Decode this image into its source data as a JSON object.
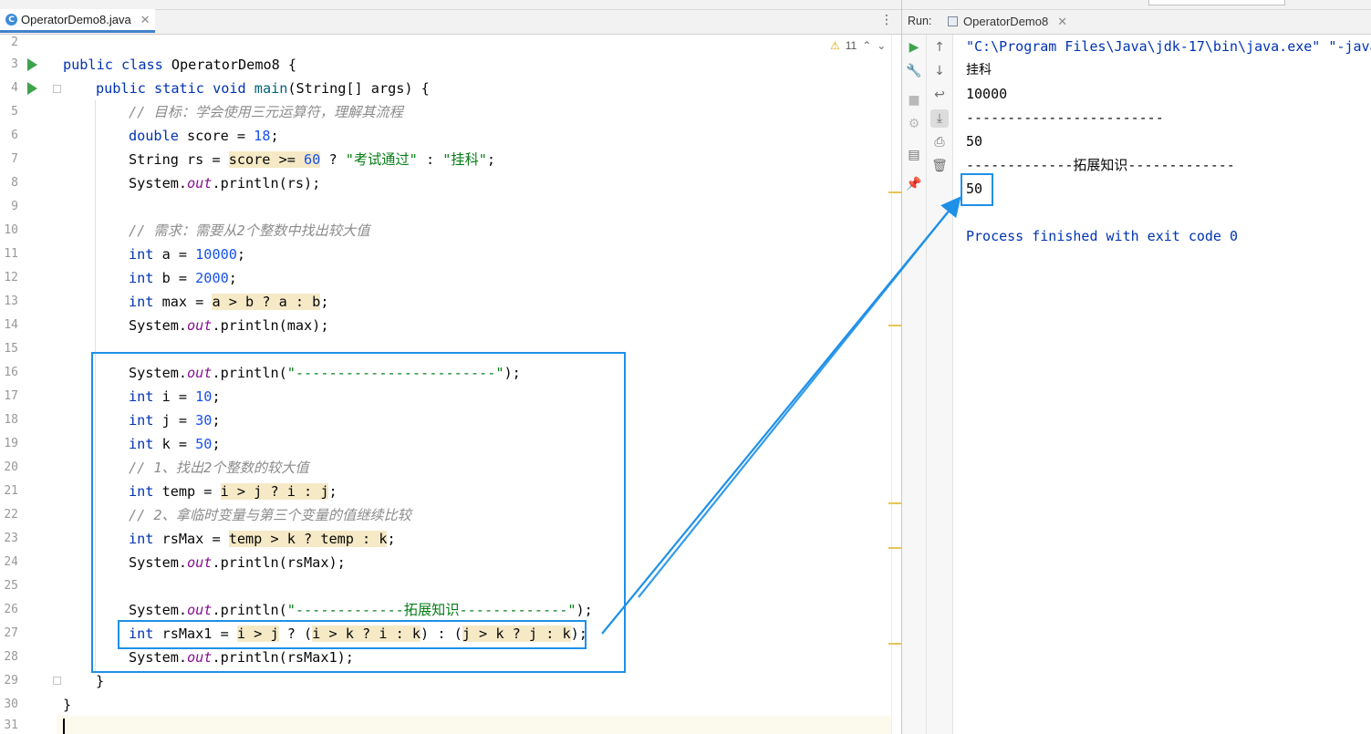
{
  "editor": {
    "tab_label": "OperatorDemo8.java",
    "tab_close": "✕",
    "menu_glyph": "⋮",
    "inspection_count": "11",
    "inspection_up": "⌃",
    "inspection_down": "⌄",
    "line_numbers": [
      "2",
      "3",
      "4",
      "5",
      "6",
      "7",
      "8",
      "9",
      "10",
      "11",
      "12",
      "13",
      "14",
      "15",
      "16",
      "17",
      "18",
      "19",
      "20",
      "21",
      "22",
      "23",
      "24",
      "25",
      "26",
      "27",
      "28",
      "29",
      "30",
      "31"
    ],
    "code": {
      "l3": {
        "kw1": "public",
        "kw2": "class",
        "rest": " OperatorDemo8 {"
      },
      "l4": {
        "kw1": "public",
        "kw2": "static",
        "kw3": "void",
        "name": "main",
        "rest": "(String[] args) {"
      },
      "l5": {
        "comment": "// 目标：学会使用三元运算符，理解其流程"
      },
      "l6": {
        "kw": "double",
        "a": " score = ",
        "n": "18",
        "b": ";"
      },
      "l7": {
        "a": "String rs = ",
        "h1": "score >= ",
        "n": "60",
        "b": " ? ",
        "s1": "\"考试通过\"",
        "c": " : ",
        "s2": "\"挂科\"",
        "d": ";"
      },
      "l8": {
        "a": "System.",
        "f": "out",
        "b": ".println(rs);"
      },
      "l10": {
        "comment": "// 需求：需要从2个整数中找出较大值"
      },
      "l11": {
        "kw": "int",
        "a": " a = ",
        "n": "10000",
        "b": ";"
      },
      "l12": {
        "kw": "int",
        "a": " b = ",
        "n": "2000",
        "b": ";"
      },
      "l13": {
        "kw": "int",
        "a": " max = ",
        "h": "a > b ? a : b",
        "b": ";"
      },
      "l14": {
        "a": "System.",
        "f": "out",
        "b": ".println(max);"
      },
      "l16": {
        "a": "System.",
        "f": "out",
        "b": ".println(",
        "s": "\"------------------------\"",
        "c": ");"
      },
      "l17": {
        "kw": "int",
        "a": " i = ",
        "n": "10",
        "b": ";"
      },
      "l18": {
        "kw": "int",
        "a": " j = ",
        "n": "30",
        "b": ";"
      },
      "l19": {
        "kw": "int",
        "a": " k = ",
        "n": "50",
        "b": ";"
      },
      "l20": {
        "comment": "// 1、找出2个整数的较大值"
      },
      "l21": {
        "kw": "int",
        "a": " temp = ",
        "h": "i > j ? i : j",
        "b": ";"
      },
      "l22": {
        "comment": "// 2、拿临时变量与第三个变量的值继续比较"
      },
      "l23": {
        "kw": "int",
        "a": " rsMax = ",
        "h": "temp > k ? temp : k",
        "b": ";"
      },
      "l24": {
        "a": "System.",
        "f": "out",
        "b": ".println(rsMax);"
      },
      "l26": {
        "a": "System.",
        "f": "out",
        "b": ".println(",
        "s": "\"-------------拓展知识-------------\"",
        "c": ");"
      },
      "l27": {
        "kw": "int",
        "a": " rsMax1 = ",
        "h1": "i > j",
        "b": " ? (",
        "h2": "i > k ? i : k",
        "c": ") : (",
        "h3": "j > k ? j : k",
        "d": ");"
      },
      "l28": {
        "a": "System.",
        "f": "out",
        "b": ".println(rsMax1);"
      },
      "l29": {
        "rest": "}"
      },
      "l30": {
        "rest": "}"
      }
    }
  },
  "run_panel": {
    "label": "Run:",
    "tab_label": "OperatorDemo8",
    "tab_close": "✕",
    "output": [
      "\"C:\\Program Files\\Java\\jdk-17\\bin\\java.exe\" \"-java",
      "挂科",
      "10000",
      "------------------------",
      "50",
      "-------------拓展知识-------------",
      "50",
      "",
      "Process finished with exit code 0"
    ]
  },
  "colors": {
    "keyword": "#0033b3",
    "number": "#1750eb",
    "string": "#067d17",
    "comment": "#8c8c8c",
    "field": "#871094",
    "highlight": "#f5e9c6",
    "annotation": "#1e90e8",
    "run_icon": "#3fa34d"
  },
  "icons": [
    "java-class-icon",
    "run-gutter-icon",
    "warning-icon",
    "rerun-icon",
    "wrench-icon",
    "stop-icon",
    "scroll-up-icon",
    "scroll-down-icon",
    "soft-wrap-icon",
    "scroll-to-end-icon",
    "print-icon",
    "trash-icon",
    "layout-icon",
    "pin-icon"
  ]
}
